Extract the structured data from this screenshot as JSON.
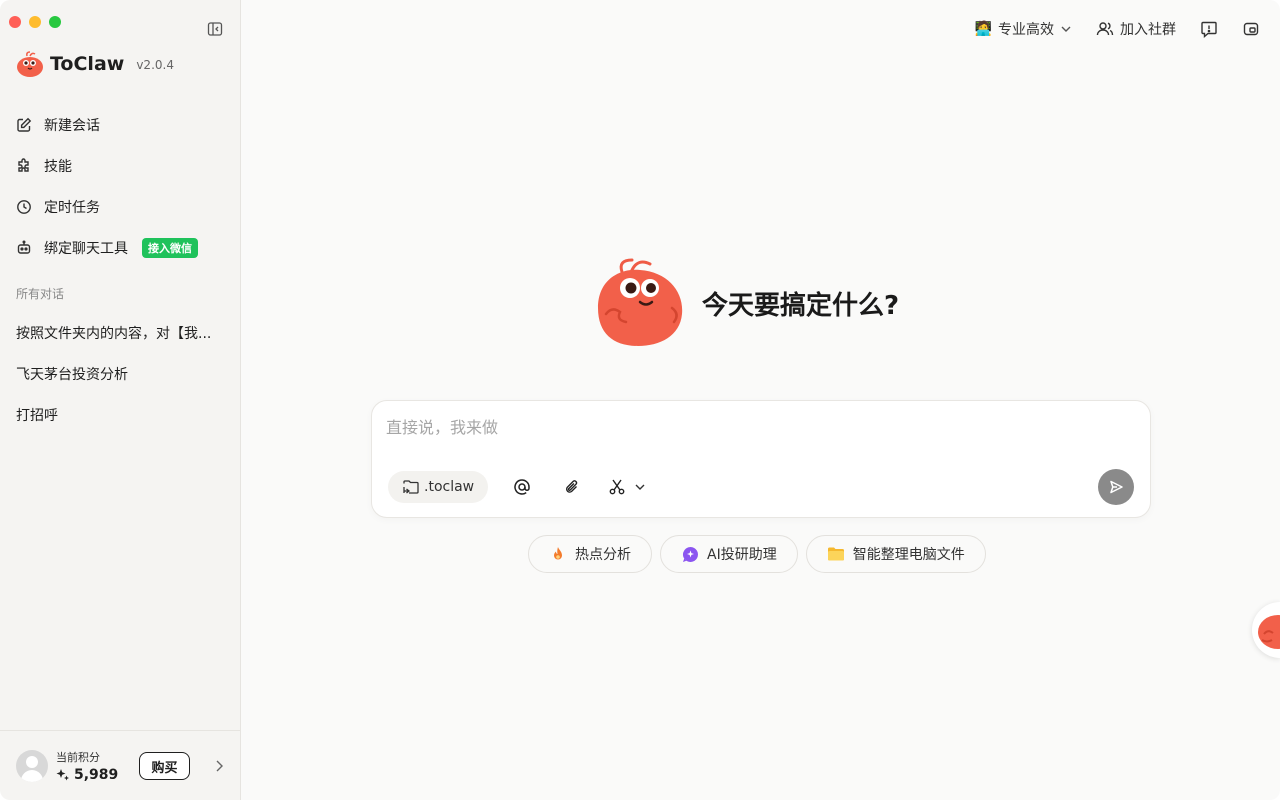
{
  "app": {
    "name": "ToClaw",
    "version": "v2.0.4"
  },
  "sidebar": {
    "nav": [
      {
        "label": "新建会话",
        "icon": "edit-icon"
      },
      {
        "label": "技能",
        "icon": "puzzle-icon"
      },
      {
        "label": "定时任务",
        "icon": "clock-icon"
      },
      {
        "label": "绑定聊天工具",
        "icon": "bot-icon",
        "badge": "接入微信"
      }
    ],
    "section_title": "所有对话",
    "conversations": [
      "按照文件夹内的内容，对【我...",
      "飞天茅台投资分析",
      "打招呼"
    ],
    "footer": {
      "points_label": "当前积分",
      "points_value": "5,989",
      "buy_label": "购买"
    }
  },
  "topbar": {
    "mode_label": "专业高效",
    "community_label": "加入社群"
  },
  "main": {
    "hero_title": "今天要搞定什么?",
    "composer": {
      "placeholder": "直接说，我来做",
      "folder_label": ".toclaw"
    },
    "suggestions": [
      {
        "label": "热点分析",
        "icon": "fire-icon"
      },
      {
        "label": "AI投研助理",
        "icon": "sparkle-icon"
      },
      {
        "label": "智能整理电脑文件",
        "icon": "folder-icon"
      }
    ]
  },
  "colors": {
    "accent": "#1fc25b",
    "mascot": "#f2604a",
    "sidebar_bg": "#f5f4f2",
    "main_bg": "#fafaf9"
  }
}
